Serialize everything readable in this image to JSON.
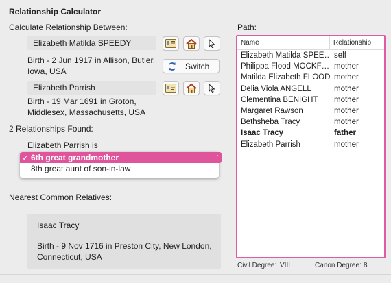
{
  "window": {
    "title": "Relationship Calculator"
  },
  "calc": {
    "between_label": "Calculate Relationship Between:",
    "person1": {
      "name": "Elizabeth Matilda SPEEDY",
      "birth": "Birth - 2 Jun 1917 in Allison, Butler, Iowa, USA"
    },
    "person2": {
      "name": "Elizabeth Parrish",
      "birth": "Birth - 19 Mar 1691 in Groton, Middlesex, Massachusetts, USA"
    },
    "switch_label": "Switch",
    "found_label": "2 Relationships Found:",
    "is_label": "Elizabeth Parrish is",
    "relationships": [
      {
        "label": "6th great grandmother",
        "selected": true,
        "check": "✓"
      },
      {
        "label": "8th great aunt of son-in-law",
        "selected": false,
        "check": ""
      }
    ]
  },
  "common": {
    "label": "Nearest Common Relatives:",
    "name": "Isaac Tracy",
    "birth": "Birth - 9 Nov 1716 in Preston City, New London, Connecticut, USA"
  },
  "path": {
    "label": "Path:",
    "columns": {
      "name": "Name",
      "relationship": "Relationship"
    },
    "rows": [
      {
        "name": "Elizabeth Matilda SPEE…",
        "rel": "self",
        "bold": false
      },
      {
        "name": "Philippa Flood MOCKF…",
        "rel": "mother",
        "bold": false
      },
      {
        "name": "Matilda Elizabeth FLOOD",
        "rel": "mother",
        "bold": false
      },
      {
        "name": "Delia Viola ANGELL",
        "rel": "mother",
        "bold": false
      },
      {
        "name": "Clementina BENIGHT",
        "rel": "mother",
        "bold": false
      },
      {
        "name": "Margaret Rawson",
        "rel": "mother",
        "bold": false
      },
      {
        "name": "Bethsheba Tracy",
        "rel": "mother",
        "bold": false
      },
      {
        "name": "Isaac Tracy",
        "rel": "father",
        "bold": true
      },
      {
        "name": "Elizabeth Parrish",
        "rel": "mother",
        "bold": false
      }
    ]
  },
  "degrees": {
    "civil_label": "Civil Degree:",
    "civil_value": "VIII",
    "canon_label": "Canon Degree:",
    "canon_value": "8"
  },
  "colors": {
    "accent": "#e0549c"
  },
  "icons": [
    "card-icon",
    "home-icon",
    "pointer-icon",
    "switch-arrows-icon"
  ]
}
